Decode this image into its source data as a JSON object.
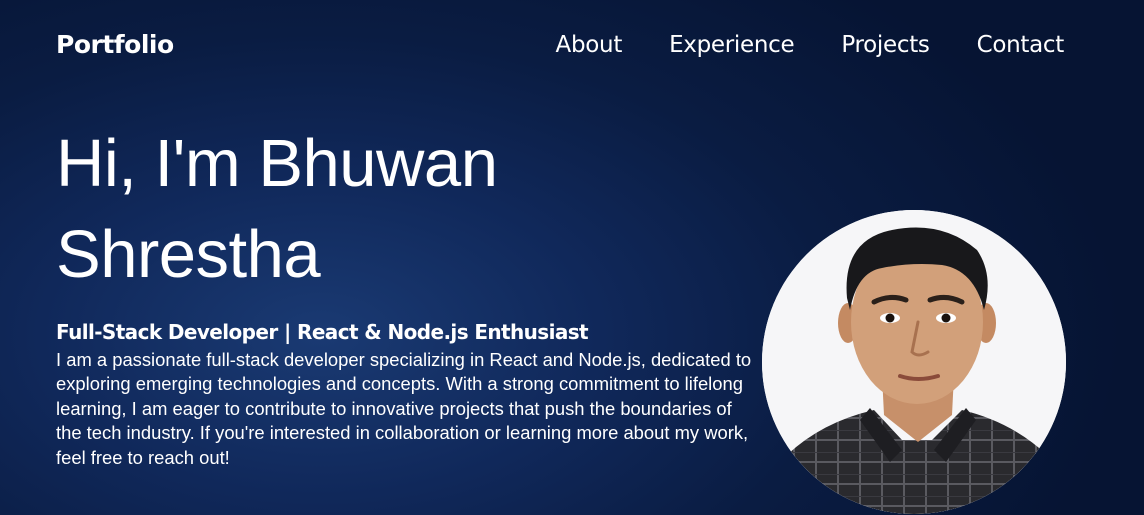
{
  "nav": {
    "brand": "Portfolio",
    "links": [
      "About",
      "Experience",
      "Projects",
      "Contact"
    ]
  },
  "hero": {
    "title_line1": "Hi, I'm Bhuwan",
    "title_line2": "Shrestha",
    "subtitle": "Full-Stack Developer | React & Node.js Enthusiast",
    "bio": "I am a passionate full-stack developer specializing in React and Node.js, dedicated to exploring emerging technologies and concepts. With a strong commitment to lifelong learning, I am eager to contribute to innovative projects that push the boundaries of the tech industry. If you're interested in collaboration or learning more about my work, feel free to reach out!"
  },
  "colors": {
    "background_dark": "#061433",
    "background_light": "#1a3a73",
    "text": "#ffffff",
    "avatar_bg": "#f6f6f8"
  }
}
